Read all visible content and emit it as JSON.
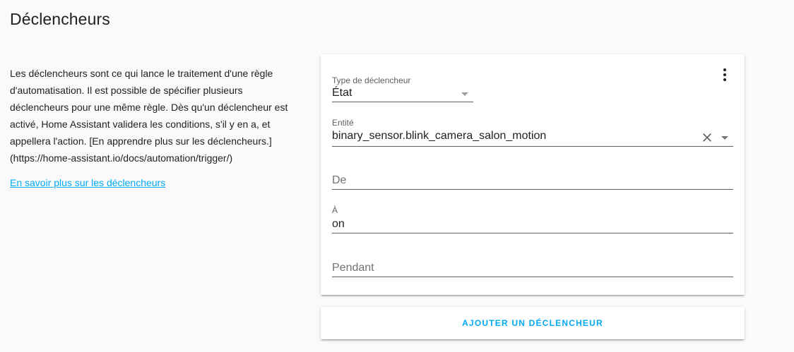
{
  "page": {
    "title": "Déclencheurs",
    "intro": "Les déclencheurs sont ce qui lance le traitement d'une règle d'automatisation. Il est possible de spécifier plusieurs déclencheurs pour une même règle. Dès qu'un déclencheur est activé, Home Assistant validera les conditions, s'il y en a, et appellera l'action. [En apprendre plus sur les déclencheurs.](https://home-assistant.io/docs/automation/trigger/)",
    "learn_more_link": "En savoir plus sur les déclencheurs"
  },
  "trigger_card": {
    "menu_icon": "dots-vertical-icon",
    "trigger_type": {
      "label": "Type de déclencheur",
      "value": "État"
    },
    "entity": {
      "label": "Entité",
      "value": "binary_sensor.blink_camera_salon_motion",
      "clear_icon": "close-icon",
      "dropdown_icon": "caret-down-icon"
    },
    "from": {
      "placeholder": "De",
      "value": ""
    },
    "to": {
      "label": "À",
      "value": "on"
    },
    "for": {
      "placeholder": "Pendant",
      "value": ""
    }
  },
  "add_trigger": {
    "label": "AJOUTER UN DÉCLENCHEUR"
  },
  "colors": {
    "accent": "#03a9f4",
    "background": "#fafafa",
    "card": "#ffffff",
    "text": "#212121"
  }
}
